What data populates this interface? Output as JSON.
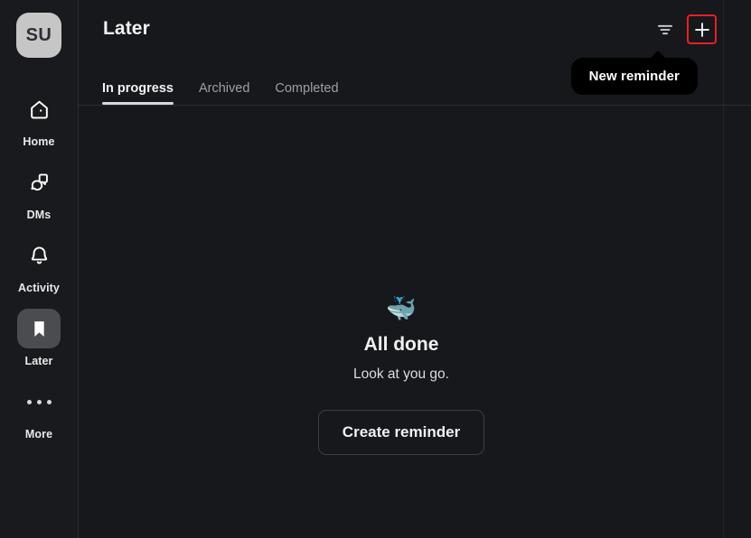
{
  "sidebar": {
    "avatar": {
      "initials": "SU",
      "name": "user-avatar",
      "bg": "#c6c6c6",
      "fg": "#2c2f36"
    },
    "items": [
      {
        "label": "Home",
        "icon": "home-icon",
        "active": false
      },
      {
        "label": "DMs",
        "icon": "dms-icon",
        "active": false
      },
      {
        "label": "Activity",
        "icon": "bell-icon",
        "active": false
      },
      {
        "label": "Later",
        "icon": "bookmark-icon",
        "active": true
      },
      {
        "label": "More",
        "icon": "more-icon",
        "active": false
      }
    ]
  },
  "header": {
    "title": "Later",
    "tabs": [
      {
        "label": "In progress",
        "active": true
      },
      {
        "label": "Archived",
        "active": false
      },
      {
        "label": "Completed",
        "active": false
      }
    ],
    "actions": {
      "filter_icon": "filter-icon",
      "new_icon": "plus-icon"
    }
  },
  "tooltip": {
    "text": "New reminder"
  },
  "empty_state": {
    "emoji": "🐳",
    "emoji_name": "whale-emoji",
    "title": "All done",
    "subtitle": "Look at you go.",
    "button_label": "Create reminder"
  },
  "colors": {
    "app_bg": "#17181c",
    "sidebar_bg": "#191a1e",
    "border": "#2a2c31",
    "accent_highlight": "#e8201f",
    "tooltip_bg": "#000000",
    "active_pill": "#4b4c50",
    "text_primary": "#f1f1f2",
    "text_muted": "#9aa0a6"
  }
}
